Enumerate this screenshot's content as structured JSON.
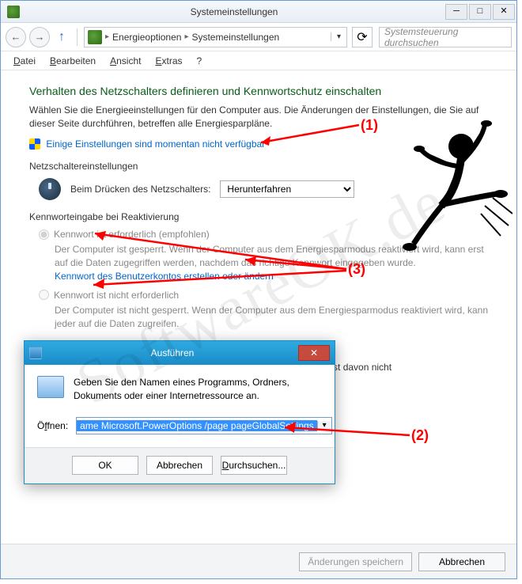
{
  "window": {
    "title": "Systemeinstellungen",
    "min": "─",
    "max": "□",
    "close": "✕"
  },
  "nav": {
    "back": "←",
    "forward": "→",
    "up": "↑",
    "crumb1": "Energieoptionen",
    "crumb2": "Systemeinstellungen",
    "refresh": "⟳",
    "search_placeholder": "Systemsteuerung durchsuchen"
  },
  "menu": {
    "file": "Datei",
    "edit": "Bearbeiten",
    "view": "Ansicht",
    "extras": "Extras",
    "help": "?"
  },
  "content": {
    "heading": "Verhalten des Netzschalters definieren und Kennwortschutz einschalten",
    "desc": "Wählen Sie die Energieeinstellungen für den Computer aus. Die Änderungen der Einstellungen, die Sie auf dieser Seite durchführen, betreffen alle Energiesparpläne.",
    "unavailable": "Einige Einstellungen sind momentan nicht verfügbar",
    "power_section": "Netzschaltereinstellungen",
    "power_label": "Beim Drücken des Netzschalters:",
    "power_value": "Herunterfahren",
    "pwd_section": "Kennworteingabe bei Reaktivierung",
    "radio1_label": "Kennwort ist erforderlich (empfohlen)",
    "radio1_text_a": "Der Computer ist gesperrt. Wenn der Computer aus dem Energiesparmodus reaktiviert wird, kann erst auf die Daten zugegriffen werden, nachdem das richtige Kennwort eingegeben wurde.",
    "radio1_link": "Kennwort des Benutzerkontos erstellen oder ändern",
    "radio2_label": "Kennwort ist nicht erforderlich",
    "radio2_text": "Der Computer ist nicht gesperrt. Wenn der Computer aus dem Energiesparmodus reaktiviert wird, kann jeder auf die Daten zugreifen.",
    "leftover": "t. Der Neustart ist davon nicht"
  },
  "footer": {
    "save": "Änderungen speichern",
    "cancel": "Abbrechen"
  },
  "run": {
    "title": "Ausführen",
    "msg": "Geben Sie den Namen eines Programms, Ordners, Dokuments oder einer Internetressource an.",
    "open_label": "Öffnen:",
    "open_value": "ame Microsoft.PowerOptions /page pageGlobalSettings",
    "ok": "OK",
    "cancel": "Abbrechen",
    "browse": "Durchsuchen..."
  },
  "annotations": {
    "a1": "(1)",
    "a2": "(2)",
    "a3": "(3)"
  },
  "watermark": "SoftwareOK.de"
}
